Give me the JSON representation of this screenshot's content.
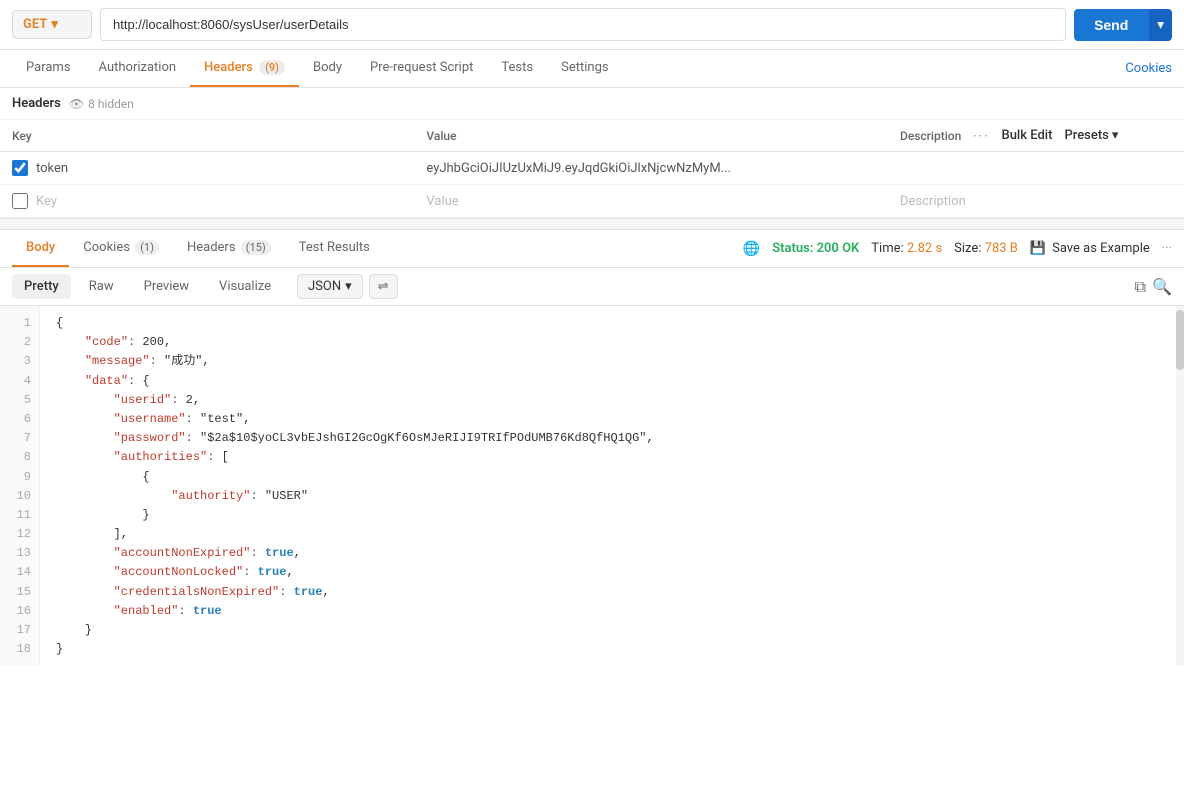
{
  "method": {
    "label": "GET",
    "chevron": "▾"
  },
  "url": {
    "value": "http://localhost:8060/sysUser/userDetails"
  },
  "send_button": {
    "label": "Send",
    "chevron": "▾"
  },
  "request_tabs": [
    {
      "id": "params",
      "label": "Params",
      "badge": null
    },
    {
      "id": "authorization",
      "label": "Authorization",
      "badge": null
    },
    {
      "id": "headers",
      "label": "Headers",
      "badge": "(9)"
    },
    {
      "id": "body",
      "label": "Body",
      "badge": null
    },
    {
      "id": "prerequest",
      "label": "Pre-request Script",
      "badge": null
    },
    {
      "id": "tests",
      "label": "Tests",
      "badge": null
    },
    {
      "id": "settings",
      "label": "Settings",
      "badge": null
    }
  ],
  "cookies_link": "Cookies",
  "headers_section": {
    "title": "Headers",
    "hidden_count": "8 hidden"
  },
  "table": {
    "col_key": "Key",
    "col_value": "Value",
    "col_desc": "Description",
    "bulk_edit": "Bulk Edit",
    "presets": "Presets",
    "rows": [
      {
        "checked": true,
        "key": "token",
        "value": "eyJhbGciOiJIUzUxMiJ9.eyJqdGkiOiJlxNjcwNzMyM...",
        "desc": ""
      }
    ],
    "empty_row": {
      "key_placeholder": "Key",
      "value_placeholder": "Value",
      "desc_placeholder": "Description"
    }
  },
  "response": {
    "tabs": [
      {
        "id": "body",
        "label": "Body",
        "badge": null,
        "active": true
      },
      {
        "id": "cookies",
        "label": "Cookies",
        "badge": "(1)",
        "active": false
      },
      {
        "id": "headers",
        "label": "Headers",
        "badge": "(15)",
        "active": false
      },
      {
        "id": "test_results",
        "label": "Test Results",
        "badge": null,
        "active": false
      }
    ],
    "status": "Status: 200 OK",
    "time": "Time: 2.82 s",
    "size": "Size: 783 B",
    "save_example": "Save as Example"
  },
  "format_bar": {
    "tabs": [
      "Pretty",
      "Raw",
      "Preview",
      "Visualize"
    ],
    "active": "Pretty",
    "format": "JSON"
  },
  "code_lines": [
    {
      "num": "1",
      "content": "{"
    },
    {
      "num": "2",
      "content": "    \"code\": 200,"
    },
    {
      "num": "3",
      "content": "    \"message\": \"成功\","
    },
    {
      "num": "4",
      "content": "    \"data\": {"
    },
    {
      "num": "5",
      "content": "        \"userid\": 2,"
    },
    {
      "num": "6",
      "content": "        \"username\": \"test\","
    },
    {
      "num": "7",
      "content": "        \"password\": \"$2a$10$yoCL3vbEJshGI2GcOgKf6OsMJeRIJI9TRIfPOdUMB76Kd8QfHQ1QG\","
    },
    {
      "num": "8",
      "content": "        \"authorities\": ["
    },
    {
      "num": "9",
      "content": "            {"
    },
    {
      "num": "10",
      "content": "                \"authority\": \"USER\""
    },
    {
      "num": "11",
      "content": "            }"
    },
    {
      "num": "12",
      "content": "        ],"
    },
    {
      "num": "13",
      "content": "        \"accountNonExpired\": true,"
    },
    {
      "num": "14",
      "content": "        \"accountNonLocked\": true,"
    },
    {
      "num": "15",
      "content": "        \"credentialsNonExpired\": true,"
    },
    {
      "num": "16",
      "content": "        \"enabled\": true"
    },
    {
      "num": "17",
      "content": "    }"
    },
    {
      "num": "18",
      "content": "}"
    }
  ]
}
